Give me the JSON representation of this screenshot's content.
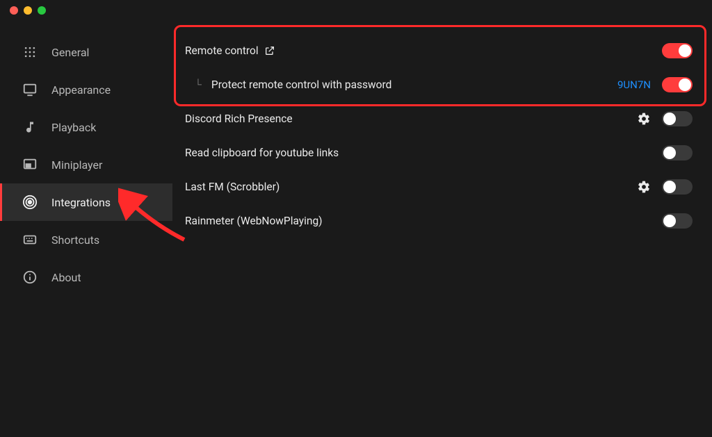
{
  "sidebar": {
    "items": [
      {
        "id": "general",
        "label": "General"
      },
      {
        "id": "appearance",
        "label": "Appearance"
      },
      {
        "id": "playback",
        "label": "Playback"
      },
      {
        "id": "miniplayer",
        "label": "Miniplayer"
      },
      {
        "id": "integrations",
        "label": "Integrations"
      },
      {
        "id": "shortcuts",
        "label": "Shortcuts"
      },
      {
        "id": "about",
        "label": "About"
      }
    ],
    "active_index": 4
  },
  "integrations": {
    "remote_control": {
      "label": "Remote control",
      "enabled": true,
      "external_link": true
    },
    "protect_remote": {
      "label": "Protect remote control with password",
      "enabled": true,
      "code": "9UN7N"
    },
    "discord": {
      "label": "Discord Rich Presence",
      "enabled": false,
      "settings": true
    },
    "clipboard": {
      "label": "Read clipboard for youtube links",
      "enabled": false
    },
    "lastfm": {
      "label": "Last FM (Scrobbler)",
      "enabled": false,
      "settings": true
    },
    "rainmeter": {
      "label": "Rainmeter (WebNowPlaying)",
      "enabled": false
    }
  },
  "colors": {
    "accent": "#ff3c3c",
    "link": "#1e90ff"
  }
}
